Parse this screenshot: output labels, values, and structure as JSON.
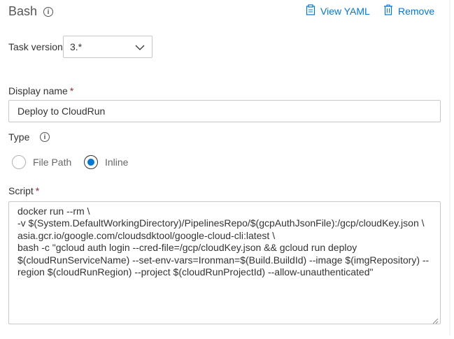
{
  "header": {
    "title": "Bash",
    "view_yaml_label": "View YAML",
    "remove_label": "Remove"
  },
  "task_version": {
    "label": "Task version",
    "selected": "3.*"
  },
  "display_name": {
    "label": "Display name",
    "required_marker": "*",
    "value": "Deploy to CloudRun"
  },
  "type": {
    "label": "Type",
    "options": [
      {
        "label": "File Path",
        "selected": false
      },
      {
        "label": "Inline",
        "selected": true
      }
    ]
  },
  "script": {
    "label": "Script",
    "required_marker": "*",
    "lines": [
      "docker run --rm \\",
      "-v $(System.DefaultWorkingDirectory)/PipelinesRepo/$(gcpAuthJsonFile):/gcp/cloudKey.json \\",
      "asia.gcr.io/google.com/cloudsdktool/google-cloud-cli:latest \\",
      "bash -c \"gcloud auth login --cred-file=/gcp/cloudKey.json && gcloud run deploy",
      "$(cloudRunServiceName) --set-env-vars=Ironman=$(Build.BuildId) --image $(imgRepository) --",
      "region $(cloudRunRegion) --project $(cloudRunProjectId) --allow-unauthenticated\""
    ]
  },
  "colors": {
    "accent": "#0078d4",
    "required": "#a4262c",
    "border": "#c8c8c8"
  }
}
